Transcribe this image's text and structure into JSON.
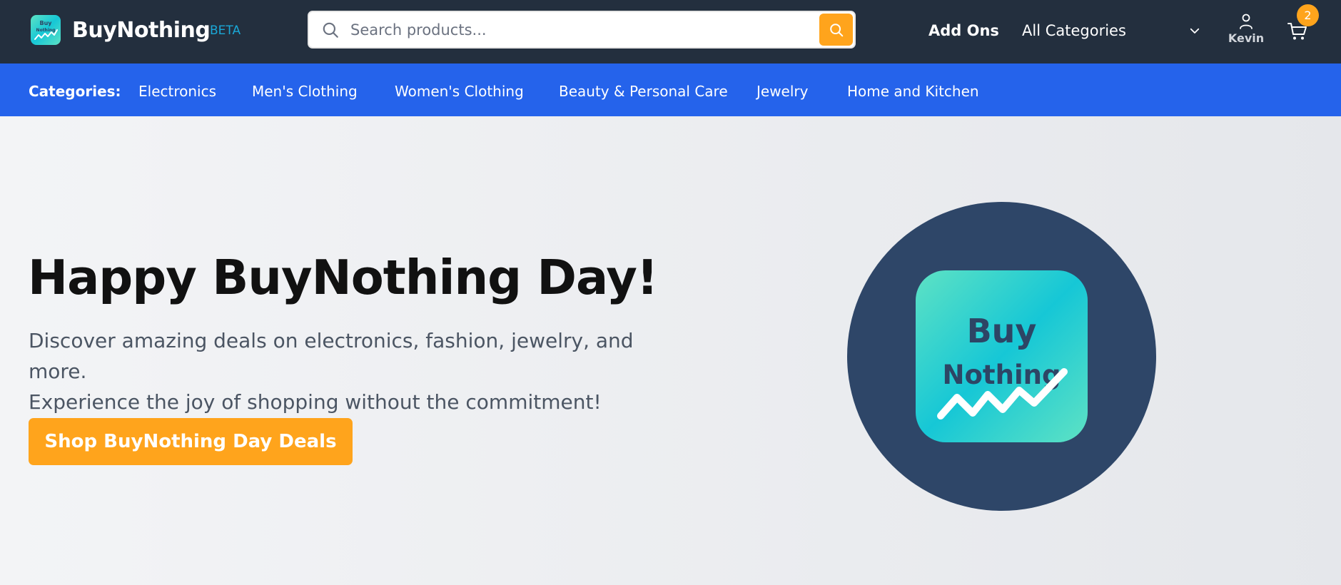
{
  "header": {
    "brand_name": "BuyNothing",
    "beta_label": "BETA",
    "logo_text_line1": "Buy",
    "logo_text_line2": "Nothing",
    "search_placeholder": "Search products...",
    "add_ons": "Add Ons",
    "all_categories": "All Categories",
    "account_name": "Kevin",
    "cart_count": "2"
  },
  "categories": {
    "label": "Categories:",
    "items": [
      "Electronics",
      "Men's Clothing",
      "Women's Clothing",
      "Beauty & Personal Care",
      "Jewelry",
      "Home and Kitchen"
    ]
  },
  "hero": {
    "title": "Happy BuyNothing Day!",
    "subtitle_line1": "Discover amazing deals on electronics, fashion, jewelry, and more.",
    "subtitle_line2": "Experience the joy of shopping without the commitment!",
    "cta": "Shop BuyNothing Day Deals"
  },
  "colors": {
    "header_bg": "#232f3e",
    "category_bar_bg": "#2563eb",
    "accent_orange": "#ffa41c",
    "beta_blue": "#1aa7d6",
    "logo_circle": "#2e4668"
  },
  "icons": [
    "search-icon",
    "chevron-down-icon",
    "user-icon",
    "cart-icon"
  ]
}
